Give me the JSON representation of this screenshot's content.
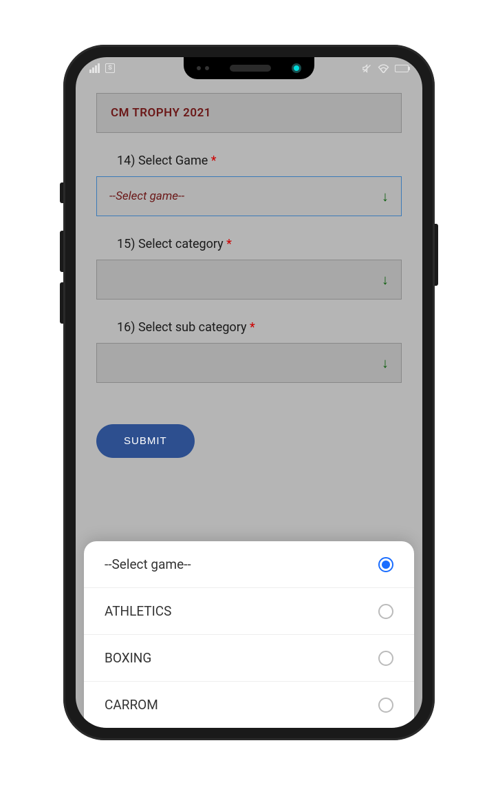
{
  "header": {
    "title": "CM TROPHY  2021"
  },
  "form": {
    "fields": [
      {
        "label": "14) Select Game ",
        "placeholder": "--Select game--",
        "selected": true
      },
      {
        "label": "15) Select category ",
        "placeholder": "",
        "selected": false
      },
      {
        "label": "16) Select sub category ",
        "placeholder": "",
        "selected": false
      }
    ],
    "required_mark": "*",
    "submit_label": "SUBMIT"
  },
  "dropdown_options": [
    {
      "label": "--Select game--",
      "checked": true
    },
    {
      "label": "ATHLETICS",
      "checked": false
    },
    {
      "label": "BOXING",
      "checked": false
    },
    {
      "label": "CARROM",
      "checked": false
    }
  ],
  "status_icons": {
    "sim_label": "S"
  }
}
